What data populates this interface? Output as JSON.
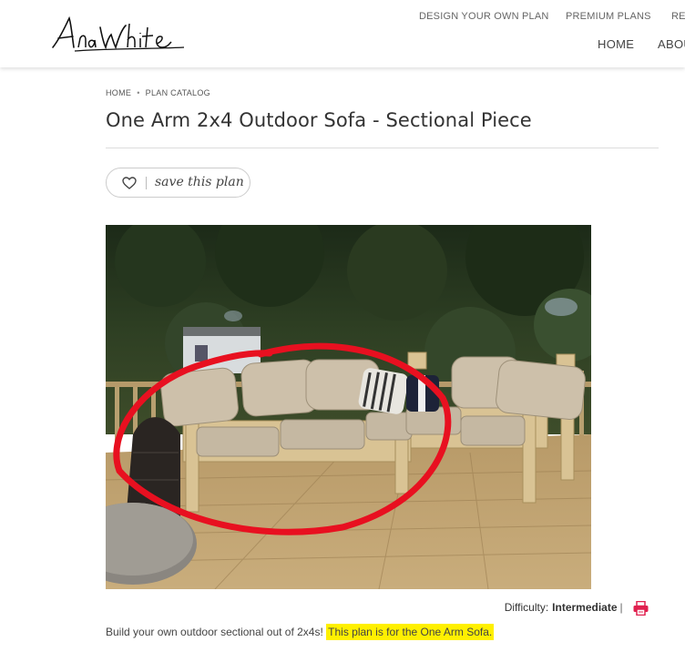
{
  "header": {
    "logo_text": "AnaWhite",
    "top_nav": [
      "DESIGN YOUR OWN PLAN",
      "PREMIUM PLANS",
      "REC"
    ],
    "main_nav": [
      "HOME",
      "ABOU"
    ]
  },
  "breadcrumb": [
    "HOME",
    "PLAN CATALOG"
  ],
  "page": {
    "title": "One Arm 2x4 Outdoor Sofa - Sectional Piece",
    "save_label": "save this plan"
  },
  "meta": {
    "difficulty_label": "Difficulty:",
    "difficulty_value": "Intermediate",
    "separator": "|",
    "print_icon": "printer-icon"
  },
  "description": {
    "text": "Build your own outdoor sectional out of 2x4s!",
    "highlight": "This plan is for the One Arm Sofa."
  },
  "colors": {
    "print_icon": "#e0204f",
    "highlight": "#fff000",
    "annotation_circle": "#e81020"
  }
}
